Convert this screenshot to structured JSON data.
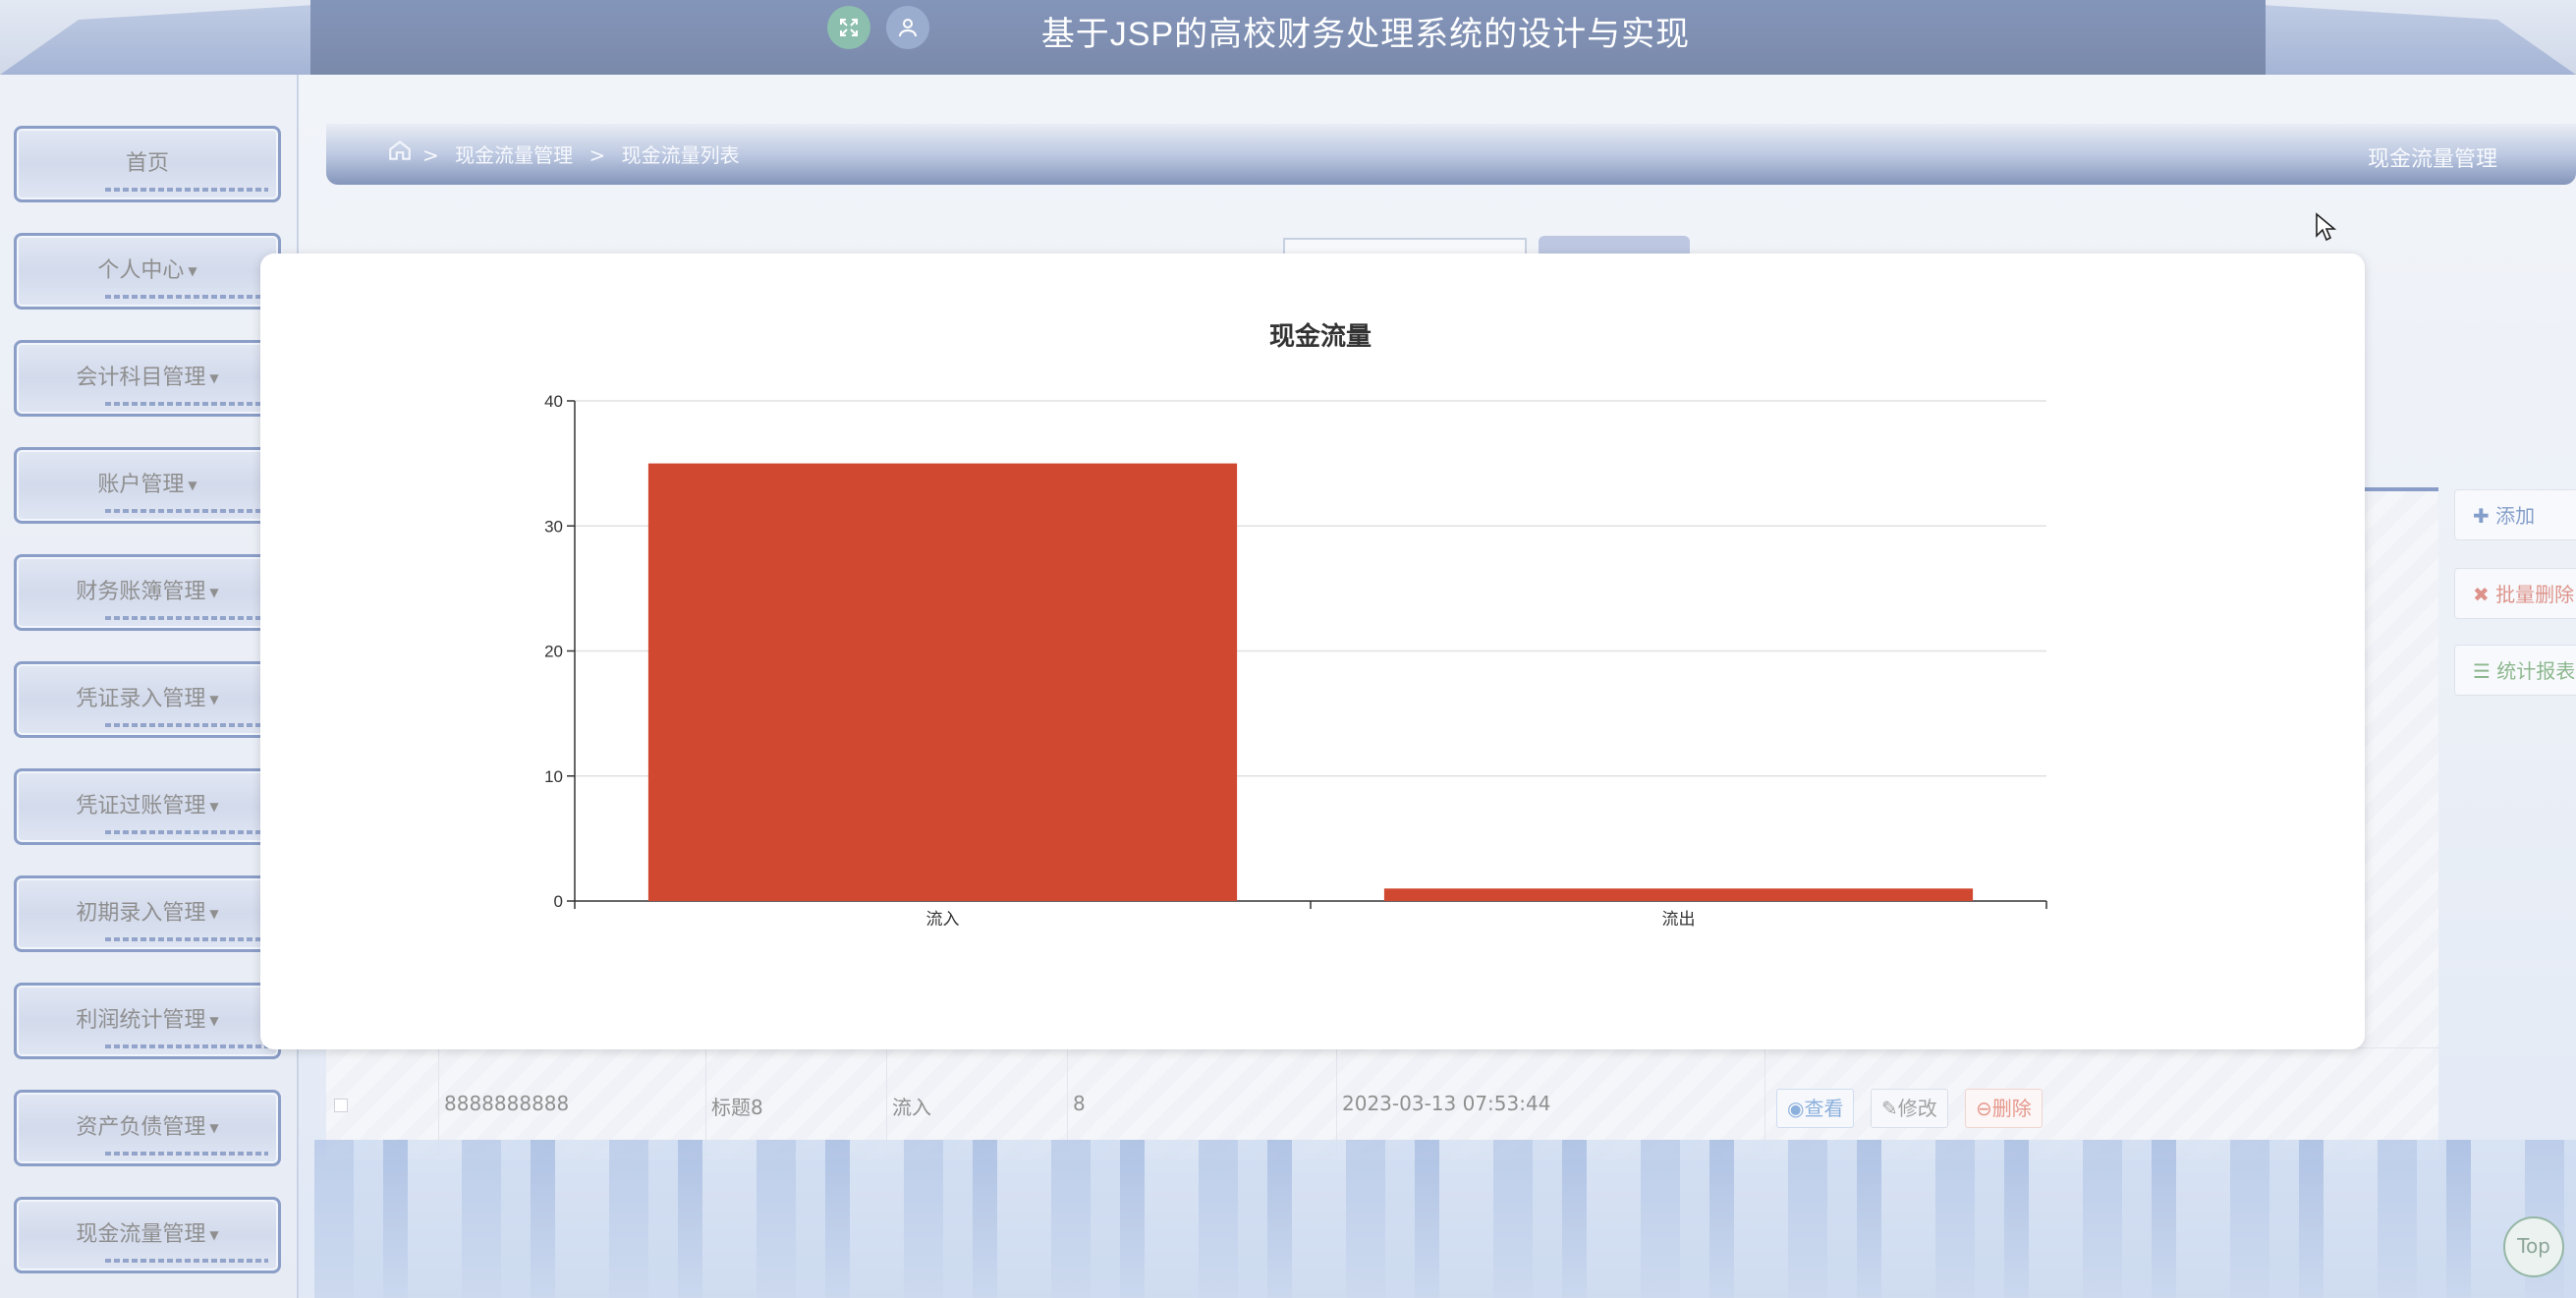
{
  "header": {
    "app_title": "基于JSP的高校财务处理系统的设计与实现",
    "icons": [
      "fullscreen-icon",
      "user-icon"
    ]
  },
  "sidebar": {
    "items": [
      {
        "label": "首页",
        "has_caret": false
      },
      {
        "label": "个人中心",
        "has_caret": true
      },
      {
        "label": "会计科目管理",
        "has_caret": true
      },
      {
        "label": "账户管理",
        "has_caret": true
      },
      {
        "label": "财务账簿管理",
        "has_caret": true
      },
      {
        "label": "凭证录入管理",
        "has_caret": true
      },
      {
        "label": "凭证过账管理",
        "has_caret": true
      },
      {
        "label": "初期录入管理",
        "has_caret": true
      },
      {
        "label": "利润统计管理",
        "has_caret": true
      },
      {
        "label": "资产负债管理",
        "has_caret": true
      },
      {
        "label": "现金流量管理",
        "has_caret": true
      }
    ]
  },
  "breadcrumb": {
    "items": [
      "现金流量管理",
      "现金流量列表"
    ],
    "separator": ">",
    "section_title": "现金流量管理"
  },
  "toolbar": {
    "add_label": "添加",
    "batch_delete_label": "批量删除",
    "report_label": "统计报表"
  },
  "table": {
    "visible_row": {
      "number": "8888888888",
      "title": "标题8",
      "type": "流入",
      "amount": "8",
      "time": "2023-03-13 07:53:44"
    },
    "actions": {
      "view": "查看",
      "edit": "修改",
      "delete": "删除"
    }
  },
  "back_to_top_label": "Top",
  "colors": {
    "bar": "#d0482f",
    "header_blue": "#0e2a66",
    "sidebar_border": "#2d4f9a"
  },
  "chart_data": {
    "type": "bar",
    "title": "现金流量",
    "categories": [
      "流入",
      "流出"
    ],
    "values": [
      35,
      1
    ],
    "ylim": [
      0,
      40
    ],
    "yticks": [
      0,
      10,
      20,
      30,
      40
    ],
    "xlabel": "",
    "ylabel": "",
    "grid": true
  }
}
